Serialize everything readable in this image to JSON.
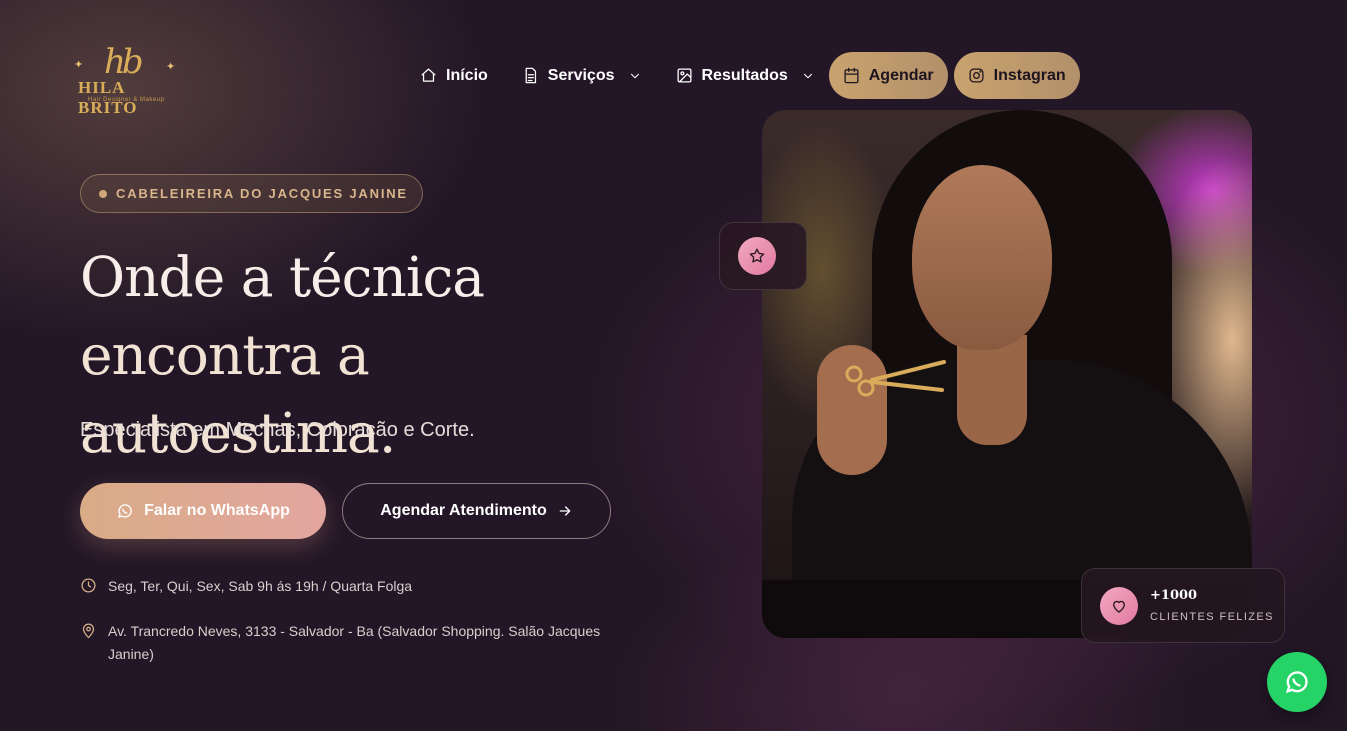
{
  "logo": {
    "monogram": "hb",
    "brand": "HILA BRITO",
    "tagline": "Hair Designer & Makeup"
  },
  "nav": {
    "items": [
      {
        "label": "Início",
        "icon": "home-icon"
      },
      {
        "label": "Serviços",
        "icon": "document-icon",
        "dropdown": true
      },
      {
        "label": "Resultados",
        "icon": "image-icon",
        "dropdown": true
      }
    ],
    "agendar": {
      "label": "Agendar",
      "icon": "calendar-icon"
    },
    "instagram": {
      "label": "Instagran",
      "icon": "instagram-icon"
    }
  },
  "hero": {
    "badge": "CABELEIREIRA DO JACQUES JANINE",
    "title_line1": "Onde a técnica",
    "title_line2": "encontra a autoestima.",
    "subtitle": "Especialista em Mechas, Coloração e Corte.",
    "cta_whatsapp": "Falar no WhatsApp",
    "cta_schedule": "Agendar Atendimento",
    "hours": "Seg, Ter, Qui, Sex, Sab 9h ás 19h / Quarta Folga",
    "address": "Av. Trancredo Neves, 3133 - Salvador - Ba (Salvador Shopping. Salão Jacques Janine)"
  },
  "stats": {
    "count": "+1000",
    "label": "CLIENTES FELIZES"
  },
  "colors": {
    "background": "#231626",
    "accent_gold": "#c9a36e",
    "accent_pink": "#e27aa0",
    "whatsapp_green": "#25d366"
  }
}
